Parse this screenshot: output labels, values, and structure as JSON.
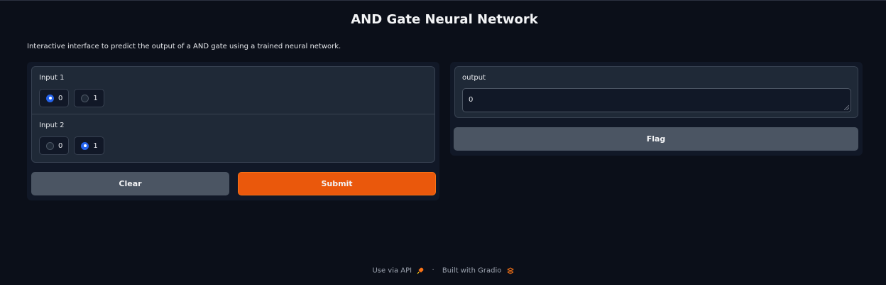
{
  "header": {
    "title": "AND Gate Neural Network",
    "description": "Interactive interface to predict the output of a AND gate using a trained neural network."
  },
  "inputs": {
    "input1": {
      "label": "Input 1",
      "options": [
        "0",
        "1"
      ],
      "selected": "0"
    },
    "input2": {
      "label": "Input 2",
      "options": [
        "0",
        "1"
      ],
      "selected": "1"
    }
  },
  "actions": {
    "clear_label": "Clear",
    "submit_label": "Submit"
  },
  "output": {
    "label": "output",
    "value": "0",
    "flag_label": "Flag"
  },
  "footer": {
    "api_text": "Use via API",
    "api_icon": "rocket-icon",
    "separator": "·",
    "built_text": "Built with Gradio",
    "built_icon": "gradio-logo-icon"
  },
  "colors": {
    "background": "#0b0f19",
    "panel": "#111827",
    "block": "#1f2937",
    "primary": "#ea580c",
    "radio_checked": "#2563eb"
  }
}
